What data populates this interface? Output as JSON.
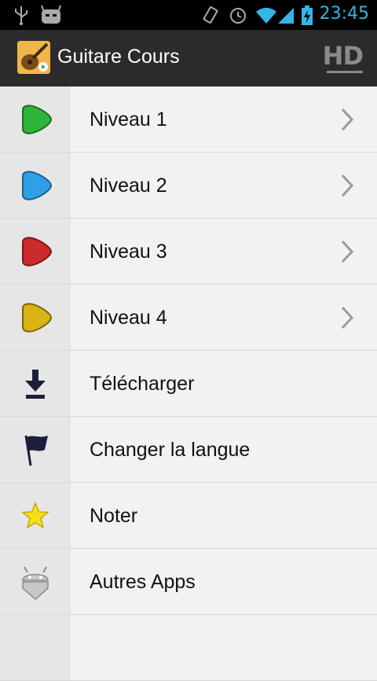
{
  "status_bar": {
    "time": "23:45"
  },
  "action_bar": {
    "title": "Guitare Cours",
    "hd_label": "HD"
  },
  "menu": {
    "items": [
      {
        "label": "Niveau 1",
        "icon": "green-pick-icon",
        "color": "#2db53a",
        "has_chevron": true
      },
      {
        "label": "Niveau 2",
        "icon": "blue-pick-icon",
        "color": "#2f9fe6",
        "has_chevron": true
      },
      {
        "label": "Niveau 3",
        "icon": "red-pick-icon",
        "color": "#cc2b2b",
        "has_chevron": true
      },
      {
        "label": "Niveau 4",
        "icon": "yellow-pick-icon",
        "color": "#d9b414",
        "has_chevron": true
      },
      {
        "label": "Télécharger",
        "icon": "download-icon",
        "has_chevron": false
      },
      {
        "label": "Changer la langue",
        "icon": "flag-icon",
        "has_chevron": false
      },
      {
        "label": "Noter",
        "icon": "star-icon",
        "has_chevron": false
      },
      {
        "label": "Autres Apps",
        "icon": "android-icon",
        "has_chevron": false
      }
    ]
  }
}
